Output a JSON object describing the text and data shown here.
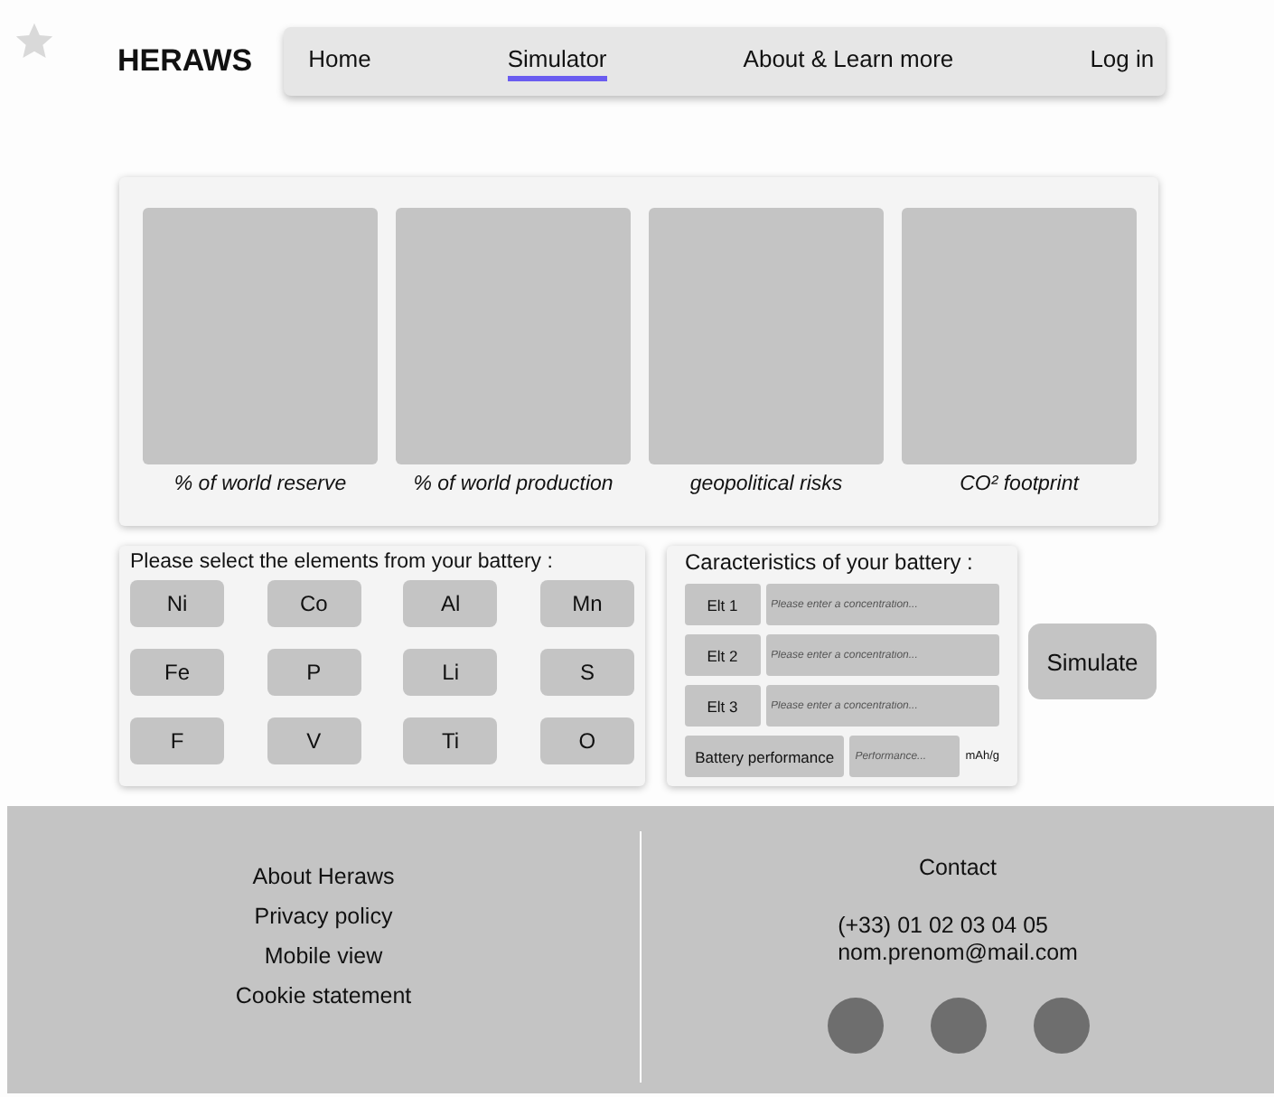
{
  "header": {
    "logo": "HERAWS",
    "nav": [
      {
        "label": "Home",
        "selected": false
      },
      {
        "label": "Simulator",
        "selected": true
      },
      {
        "label": "About & Learn more",
        "selected": false
      },
      {
        "label": "Log in",
        "selected": false
      }
    ]
  },
  "indicators": [
    {
      "caption": "% of world reserve"
    },
    {
      "caption": "% of world production"
    },
    {
      "caption": "geopolitical risks"
    },
    {
      "caption": "CO² footprint"
    }
  ],
  "elements": {
    "title": "Please select the elements from your battery :",
    "items": [
      "Ni",
      "Co",
      "Al",
      "Mn",
      "Fe",
      "P",
      "Li",
      "S",
      "F",
      "V",
      "Ti",
      "O"
    ]
  },
  "characteristics": {
    "title": "Caracteristics of your battery :",
    "rows": [
      {
        "label": "Elt 1",
        "placeholder": "Please enter a concentration..."
      },
      {
        "label": "Elt 2",
        "placeholder": "Please enter a concentration..."
      },
      {
        "label": "Elt 3",
        "placeholder": "Please enter a concentration..."
      }
    ],
    "performance": {
      "label": "Battery performance",
      "placeholder": "Performance...",
      "unit": "mAh/g"
    }
  },
  "simulate_button": "Simulate",
  "footer": {
    "links": [
      "About Heraws",
      "Privacy policy",
      "Mobile view",
      "Cookie statement"
    ],
    "contact_title": "Contact",
    "phone": "(+33) 01 02 03 04 05",
    "email": "nom.prenom@mail.com",
    "socials": [
      {
        "kind": "circle"
      },
      {
        "kind": "circle"
      },
      {
        "kind": "circle"
      }
    ]
  }
}
